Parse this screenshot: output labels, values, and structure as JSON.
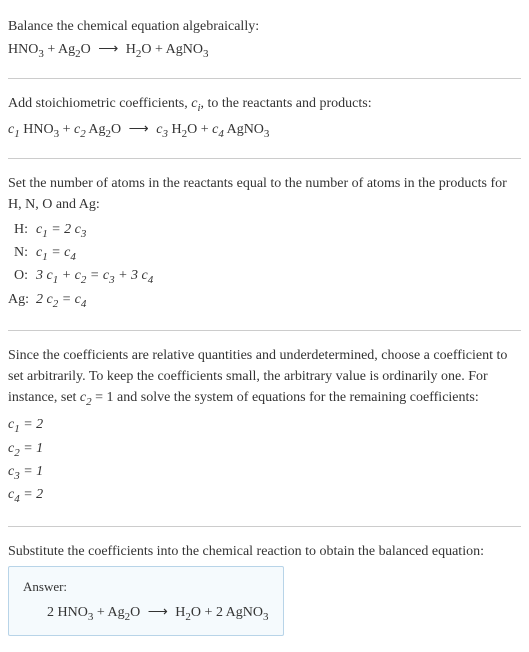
{
  "intro": {
    "line1": "Balance the chemical equation algebraically:",
    "reactant1": "HNO",
    "reactant1_sub": "3",
    "reactant2": "Ag",
    "reactant2_sub": "2",
    "reactant2b": "O",
    "product1": "H",
    "product1_sub": "2",
    "product1b": "O",
    "product2": "AgNO",
    "product2_sub": "3"
  },
  "stoich": {
    "text1": "Add stoichiometric coefficients, ",
    "ci": "c",
    "ci_sub": "i",
    "text2": ", to the reactants and products:",
    "c1": "c",
    "c1_sub": "1",
    "r1": "HNO",
    "r1_sub": "3",
    "c2": "c",
    "c2_sub": "2",
    "r2": "Ag",
    "r2_sub": "2",
    "r2b": "O",
    "c3": "c",
    "c3_sub": "3",
    "p1": "H",
    "p1_sub": "2",
    "p1b": "O",
    "c4": "c",
    "c4_sub": "4",
    "p2": "AgNO",
    "p2_sub": "3"
  },
  "atoms": {
    "intro": "Set the number of atoms in the reactants equal to the number of atoms in the products for H, N, O and Ag:",
    "rows": [
      {
        "label": "H:",
        "eq_lhs": "c",
        "eq_lhs_sub": "1",
        "eq_mid": " = 2 ",
        "eq_rhs": "c",
        "eq_rhs_sub": "3",
        "tail": ""
      },
      {
        "label": "N:",
        "eq_lhs": "c",
        "eq_lhs_sub": "1",
        "eq_mid": " = ",
        "eq_rhs": "c",
        "eq_rhs_sub": "4",
        "tail": ""
      },
      {
        "label": "O:",
        "eq_full": "3 c₁ + c₂ = c₃ + 3 c₄"
      },
      {
        "label": "Ag:",
        "eq_full": "2 c₂ = c₄"
      }
    ]
  },
  "choose": {
    "text1": "Since the coefficients are relative quantities and underdetermined, choose a coefficient to set arbitrarily. To keep the coefficients small, the arbitrary value is ordinarily one. For instance, set ",
    "cvar": "c",
    "cvar_sub": "2",
    "text2": " = 1 and solve the system of equations for the remaining coefficients:",
    "coeffs": [
      {
        "var": "c",
        "sub": "1",
        "val": " = 2"
      },
      {
        "var": "c",
        "sub": "2",
        "val": " = 1"
      },
      {
        "var": "c",
        "sub": "3",
        "val": " = 1"
      },
      {
        "var": "c",
        "sub": "4",
        "val": " = 2"
      }
    ]
  },
  "final": {
    "text": "Substitute the coefficients into the chemical reaction to obtain the balanced equation:"
  },
  "answer": {
    "label": "Answer:",
    "coef1": "2 ",
    "r1": "HNO",
    "r1_sub": "3",
    "plus1": " + ",
    "r2": "Ag",
    "r2_sub": "2",
    "r2b": "O",
    "coef3": "",
    "p1": "H",
    "p1_sub": "2",
    "p1b": "O",
    "plus2": " + 2 ",
    "p2": "AgNO",
    "p2_sub": "3"
  },
  "chart_data": {
    "type": "table",
    "title": "Balanced chemical equation",
    "input_equation": "HNO3 + Ag2O -> H2O + AgNO3",
    "elements": [
      "H",
      "N",
      "O",
      "Ag"
    ],
    "balance_equations": [
      "c1 = 2 c3",
      "c1 = c4",
      "3 c1 + c2 = c3 + 3 c4",
      "2 c2 = c4"
    ],
    "coefficients": {
      "c1": 2,
      "c2": 1,
      "c3": 1,
      "c4": 2
    },
    "balanced_equation": "2 HNO3 + Ag2O -> H2O + 2 AgNO3"
  }
}
